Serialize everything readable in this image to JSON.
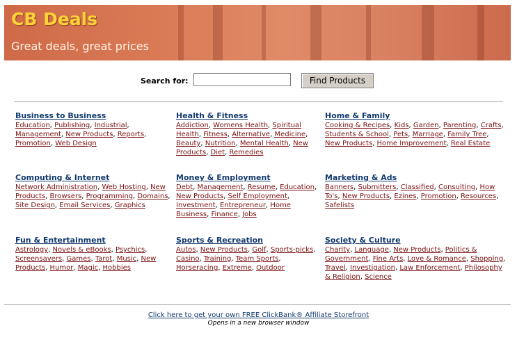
{
  "header": {
    "title": "CB Deals",
    "tagline": "Great deals, great prices"
  },
  "search": {
    "label": "Search for:",
    "value": "",
    "button_label": "Find Products"
  },
  "categories": [
    {
      "title": "Business to Business",
      "links": [
        "Education",
        "Publishing",
        "Industrial",
        "Management",
        "New Products",
        "Reports",
        "Promotion",
        "Web Design"
      ]
    },
    {
      "title": "Health & Fitness",
      "links": [
        "Addiction",
        "Womens Health",
        "Spiritual Health",
        "Fitness",
        "Alternative",
        "Medicine",
        "Beauty",
        "Nutrition",
        "Mental Health",
        "New Products",
        "Diet",
        "Remedies"
      ]
    },
    {
      "title": "Home & Family",
      "links": [
        "Cooking & Recipes",
        "Kids",
        "Garden",
        "Parenting",
        "Crafts",
        "Students & School",
        "Pets",
        "Marriage",
        "Family Tree",
        "New Products",
        "Home Improvement",
        "Real Estate"
      ]
    },
    {
      "title": "Computing & Internet",
      "links": [
        "Network Administration",
        "Web Hosting",
        "New Products",
        "Browsers",
        "Programming",
        "Domains",
        "Site Design",
        "Email Services",
        "Graphics"
      ]
    },
    {
      "title": "Money & Employment",
      "links": [
        "Debt",
        "Management",
        "Resume",
        "Education",
        "New Products",
        "Self Employment",
        "Investment",
        "Entrepreneur",
        "Home Business",
        "Finance",
        "Jobs"
      ]
    },
    {
      "title": "Marketing & Ads",
      "links": [
        "Banners",
        "Submitters",
        "Classified",
        "Consulting",
        "How To's",
        "New Products",
        "Ezines",
        "Promotion",
        "Resources",
        "Safelists"
      ]
    },
    {
      "title": "Fun & Entertainment",
      "links": [
        "Astrology",
        "Novels & eBooks",
        "Psychics",
        "Screensavers",
        "Games",
        "Tarot",
        "Music",
        "New Products",
        "Humor",
        "Magic",
        "Hobbies"
      ]
    },
    {
      "title": "Sports & Recreation",
      "links": [
        "Autos",
        "New Products",
        "Golf",
        "Sports-picks",
        "Casino",
        "Training",
        "Team Sports",
        "Horseracing",
        "Extreme",
        "Outdoor"
      ]
    },
    {
      "title": "Society & Culture",
      "links": [
        "Charity",
        "Language",
        "New Products",
        "Politics & Government",
        "Fine Arts",
        "Love & Romance",
        "Shopping",
        "Travel",
        "Investigation",
        "Law Enforcement",
        "Philosophy & Religion",
        "Science"
      ]
    }
  ],
  "footer": {
    "link_text": "Click here to get your own FREE ClickBank® Affiliate Storefront",
    "note": "Opens in a new browser window"
  },
  "colors": {
    "banner": "#d97a55",
    "title_yellow": "#ffd23a",
    "category_title": "#123a6e",
    "link": "#7a1010"
  }
}
